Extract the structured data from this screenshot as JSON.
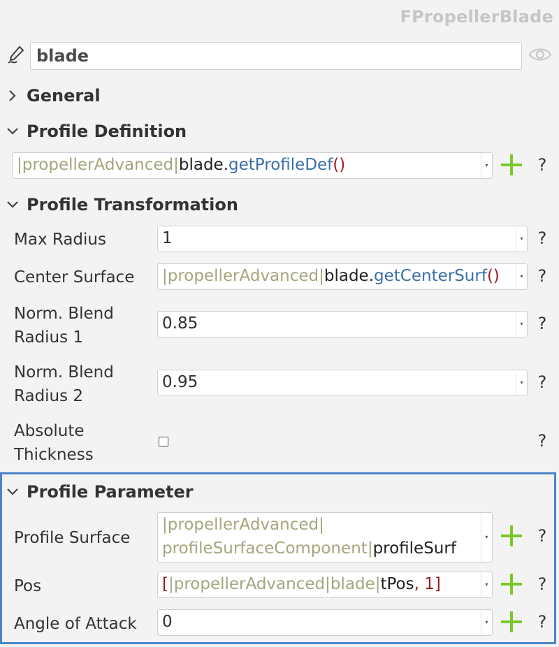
{
  "header": {
    "type_name": "FPropellerBlade",
    "name_value": "blade"
  },
  "sections": {
    "general": "General",
    "profile_definition": "Profile Definition",
    "profile_transformation": "Profile Transformation",
    "profile_parameter": "Profile Parameter"
  },
  "profile_definition": {
    "pipe1": "|",
    "ns": "propellerAdvanced",
    "pipe2": "|",
    "obj": "blade",
    "dot": ".",
    "fn": "getProfileDef",
    "paren": "()"
  },
  "transformation": {
    "max_radius_label": "Max Radius",
    "max_radius_value": "1",
    "center_surface_label": "Center Surface",
    "center_surface": {
      "pipe1": "|",
      "ns": "propellerAdvanced",
      "pipe2": "|",
      "obj": "blade",
      "dot": ".",
      "fn": "getCenterSurf",
      "paren": "()"
    },
    "blend1_label_line1": "Norm. Blend",
    "blend1_label_line2": "Radius 1",
    "blend1_value": "0.85",
    "blend2_label_line1": "Norm. Blend",
    "blend2_label_line2": "Radius 2",
    "blend2_value": "0.95",
    "abs_thickness_label_line1": "Absolute",
    "abs_thickness_label_line2": "Thickness"
  },
  "parameter": {
    "profile_surface_label": "Profile Surface",
    "profile_surface": {
      "pipe1": "|",
      "ns": "propellerAdvanced",
      "pipe2": "|",
      "comp": "profileSurfaceComponent",
      "pipe3": "|",
      "obj": "profileSurf"
    },
    "pos_label": "Pos",
    "pos": {
      "open": "[",
      "pipe1": "|",
      "ns": "propellerAdvanced",
      "pipe2": "|",
      "mid": "blade",
      "pipe3": "|",
      "obj": "tPos",
      "rest": ", 1",
      "close": "]"
    },
    "aoa_label": "Angle of Attack",
    "aoa_value": "0"
  },
  "help_glyph": "?",
  "dropdown_glyph": "▾",
  "colors": {
    "plus": "#7cc72a",
    "highlight": "#4a84c8",
    "namespace": "#a5a57e",
    "function": "#3b6fa8",
    "paren": "#9b1c1c"
  }
}
